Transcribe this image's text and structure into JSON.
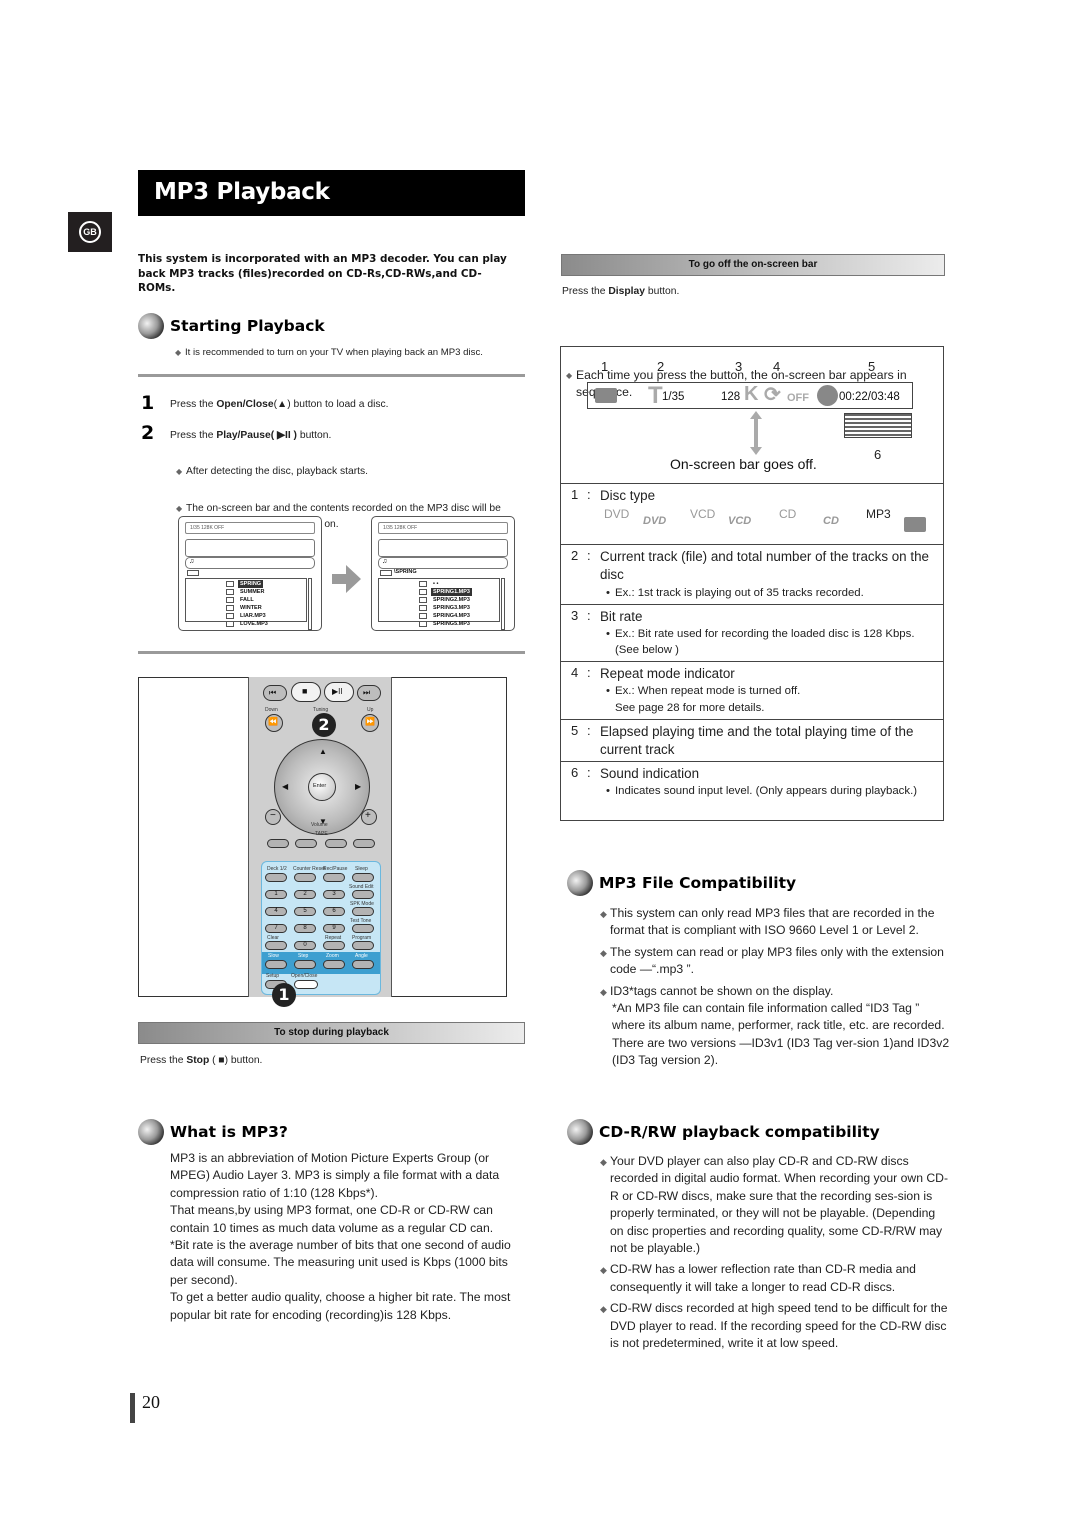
{
  "page": {
    "title": "MP3 Playback",
    "language_badge": "GB",
    "page_number": "20"
  },
  "intro": "This system is incorporated with an MP3 decoder. You can play back MP3 tracks (files)recorded on CD-Rs,CD-RWs,and CD-ROMs.",
  "starting_playback": {
    "heading": "Starting Playback",
    "note": "It is recommended to turn on your TV when playing back an MP3 disc.",
    "steps": [
      {
        "num": "1",
        "pre": "Press the ",
        "bold": "Open/Close",
        "symbol": "(▲)",
        "post": " button to load a disc."
      },
      {
        "num": "2",
        "pre": "Press the ",
        "bold": "Play/Pause",
        "symbol": "( ▶II )",
        "post": " button."
      }
    ],
    "step2_bullets": [
      "After detecting the disc, playback starts.",
      "The on-screen bar and the contents recorded on the MP3 disc will be shown on the TV if it is turned on."
    ],
    "screen_left": {
      "bar_text": "1/35  128K  OFF",
      "path": "",
      "items": [
        "SPRING",
        "SUMMER",
        "FALL",
        "WINTER",
        "LIAR.MP3",
        "LOVE.MP3"
      ],
      "selected": 0
    },
    "screen_right": {
      "bar_text": "1/35  128K  OFF",
      "path": "\\SPRING",
      "items": [
        "• •",
        "SPRING1.MP3",
        "SPRING2.MP3",
        "SPRING3.MP3",
        "SPRING4.MP3",
        "SPRING5.MP3"
      ],
      "selected": 1
    }
  },
  "remote": {
    "labels": {
      "down": "Down",
      "tuning": "Tuning",
      "up": "Up",
      "enter": "Enter",
      "volume": "Volume",
      "tape": "TAPE",
      "deck": "Deck 1/2",
      "counter_reset": "Counter Reset",
      "rec_pause": "Rec/Pause",
      "sleep": "Sleep",
      "sound_edit": "Sound Edit",
      "spk_mode": "SPK Mode",
      "test_tone": "Test Tone",
      "clear": "Clear",
      "repeat": "Repeat",
      "program": "Program",
      "slow": "Slow",
      "step": "Step",
      "zoom": "Zoom",
      "angle": "Angle",
      "setup": "Setup",
      "open_close": "Open/Close"
    },
    "digits": [
      "1",
      "2",
      "3",
      "4",
      "5",
      "6",
      "7",
      "8",
      "9",
      "0"
    ],
    "callouts": [
      "2",
      "1"
    ]
  },
  "stop_playback": {
    "bar_label": "To stop during playback",
    "pre": "Press the ",
    "bold": "Stop",
    "symbol": " ( ■) ",
    "post": "button."
  },
  "what_is_mp3": {
    "heading": "What is MP3?",
    "paragraphs": [
      "MP3 is an abbreviation of Motion Picture Experts Group (or MPEG) Audio Layer 3. MP3 is simply a file format with a data compression ratio of 1:10 (128 Kbps*).",
      "That means,by using MP3 format, one CD-R or CD-RW can contain 10 times as much data volume as a regular CD can.",
      "*Bit rate is the average number of bits that one second of audio data will consume. The measuring unit used is Kbps (1000 bits per second).",
      "To get a better audio quality, choose a higher bit rate. The most popular bit rate for encoding (recording)is 128 Kbps."
    ]
  },
  "onscreen_bar": {
    "bar_label": "To go off the on-screen bar",
    "instruction_pre": "Press the ",
    "instruction_bold": "Display",
    "instruction_post": " button.",
    "bullet": "Each time you press the button, the on-screen bar appears in sequence.",
    "diagram": {
      "markers": [
        "1",
        "2",
        "3",
        "4",
        "5",
        "6"
      ],
      "track": "1/35",
      "bitrate": "128",
      "bitrate_unit": "K",
      "repeat": "OFF",
      "time": "00:22/03:48",
      "caption": "On-screen bar goes off."
    },
    "items": [
      {
        "num": "1",
        "label": "Disc type",
        "discs": [
          "DVD",
          "VCD",
          "CD",
          "MP3"
        ]
      },
      {
        "num": "2",
        "label": "Current track (file) and total number of the tracks on the disc",
        "sub": "Ex.: 1st track is playing out of 35 tracks recorded."
      },
      {
        "num": "3",
        "label": "Bit rate",
        "sub": "Ex.: Bit rate used for recording the loaded disc is 128 Kbps. (See below )"
      },
      {
        "num": "4",
        "label": "Repeat mode indicator",
        "sub": "Ex.: When repeat mode is turned off.",
        "sub2": "See page 28 for more details."
      },
      {
        "num": "5",
        "label": "Elapsed playing time and the total playing time of the current track"
      },
      {
        "num": "6",
        "label": "Sound indication",
        "sub": "Indicates sound input level. (Only appears during playback.)"
      }
    ]
  },
  "file_compat": {
    "heading": "MP3 File Compatibility",
    "bullets": [
      "This system can only read MP3 files that are recorded in the format that is compliant with ISO 9660 Level 1 or Level 2.",
      "The system can read or play MP3 files only with the extension code —“.mp3 ”.",
      "ID3*tags cannot be shown on the display."
    ],
    "footnote": "*An MP3 file can contain file information called “ID3 Tag ” where its album name, performer, rack title, etc. are recorded. There are two versions —ID3v1 (ID3 Tag ver-sion 1)and ID3v2 (ID3 Tag version 2)."
  },
  "cdrw_compat": {
    "heading": "CD-R/RW playback compatibility",
    "bullets": [
      "Your DVD player can also play CD-R and CD-RW discs recorded in digital audio format. When recording your own CD-R or CD-RW discs, make sure that the recording ses-sion is properly terminated, or they will not be playable. (Depending on disc properties and recording quality, some CD-R/RW may not be playable.)",
      "CD-RW has a lower reflection rate than CD-R media and consequently it will take a longer to read CD-R discs.",
      "CD-RW discs recorded at high speed tend to be difficult for the DVD player to read. If the recording speed for the CD-RW disc is not predetermined, write it at low speed."
    ]
  }
}
